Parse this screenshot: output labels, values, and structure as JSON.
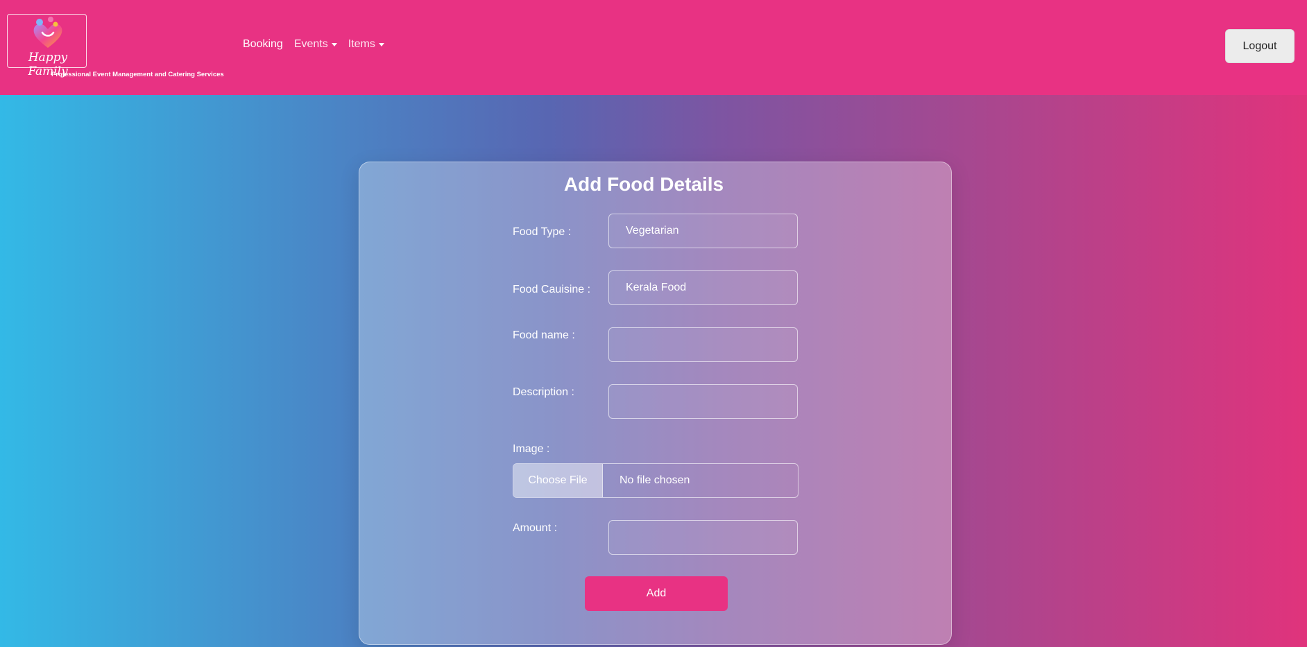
{
  "brand": {
    "name": "Happy Family",
    "tagline": "Professional Event Management and Catering Services"
  },
  "nav": {
    "booking": "Booking",
    "events": "Events",
    "items": "Items",
    "logout": "Logout"
  },
  "form": {
    "title": "Add Food Details",
    "food_type": {
      "label": "Food Type :",
      "value": "Vegetarian"
    },
    "food_cuisine": {
      "label": "Food Cauisine :",
      "value": "Kerala Food"
    },
    "food_name": {
      "label": "Food name :",
      "value": ""
    },
    "description": {
      "label": "Description :",
      "value": ""
    },
    "image": {
      "label": "Image :",
      "button": "Choose File",
      "status": "No file chosen"
    },
    "amount": {
      "label": "Amount :",
      "value": ""
    },
    "submit": "Add"
  },
  "colors": {
    "primary_pink": "#e83283",
    "gradient_start": "#33b9e6",
    "gradient_end": "#e0337c"
  }
}
